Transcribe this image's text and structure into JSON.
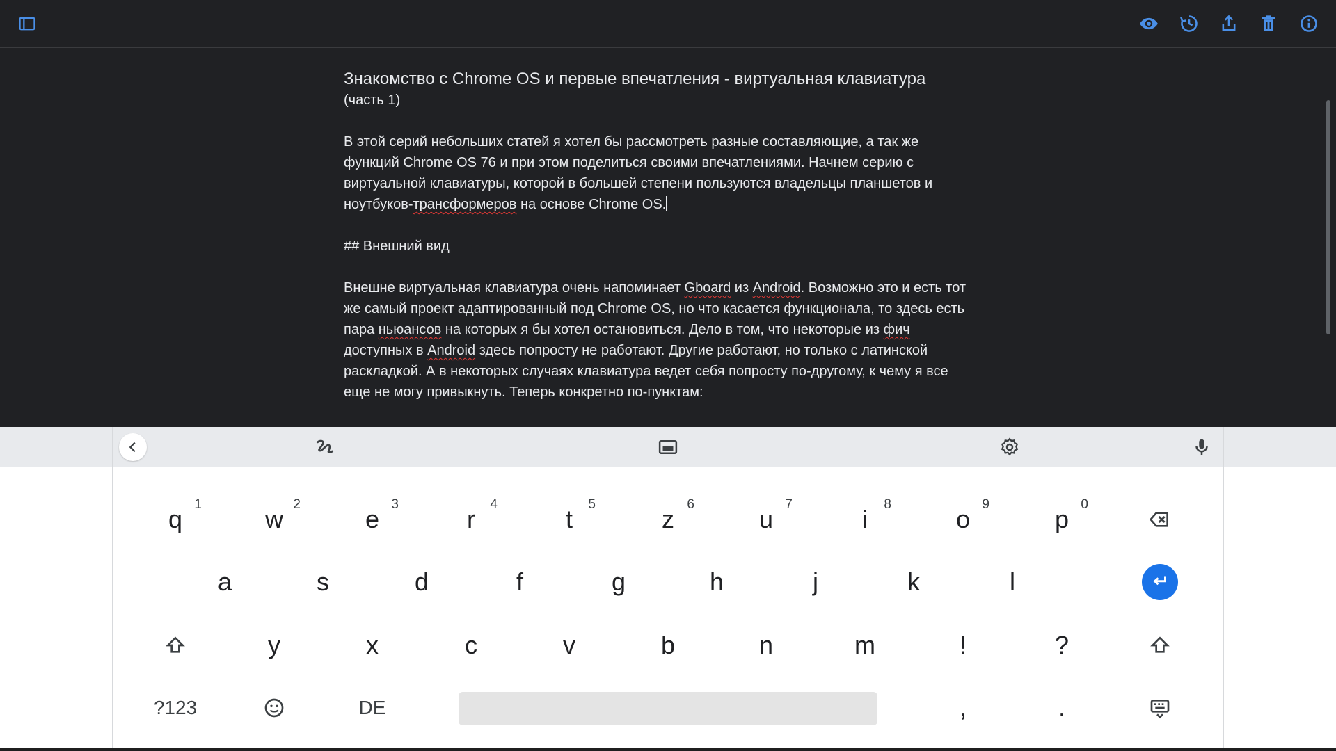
{
  "colors": {
    "accent": "#4a8fe7",
    "enter": "#1a73e8",
    "background": "#202124",
    "spell_error": "#e53935"
  },
  "topbar": {
    "left_icon": "sidebar-toggle-icon",
    "right_icons": [
      "eye-icon",
      "history-icon",
      "share-icon",
      "trash-icon",
      "info-icon"
    ]
  },
  "document": {
    "title": "Знакомство с Chrome OS и первые впечатления - виртуальная клавиатура",
    "subtitle": "(часть 1)",
    "p1_a": "В этой серий небольших статей я хотел бы рассмотреть разные составляющие, а так же\nфункций Chrome OS 76 и при этом поделиться своими впечатлениями. Начнем серию с\nвиртуальной клавиатуры, которой в большей степени пользуются владельцы планшетов и\nноутбуков-",
    "p1_b": "трансформеров",
    "p1_c": " на основе Chrome OS.",
    "heading": "## Внешний вид",
    "p2_1": "Внешне виртуальная клавиатура очень напоминает ",
    "p2_gboard": "Gboard",
    "p2_2": " из ",
    "p2_android1": "Android",
    "p2_3": ". Возможно это и есть тот\nже самый проект адаптированный под Chrome OS, но что касается функционала, то здесь есть\nпара ",
    "p2_nuances": "ньюансов",
    "p2_4": " на которых я бы хотел остановиться. Дело в том, что некоторые из ",
    "p2_fich": "фич",
    "p2_5": "\nдоступных в ",
    "p2_android2": "Android",
    "p2_6": " здесь попросту не работают. Другие работают, но только с латинской\nраскладкой. А в некоторых случаях клавиатура ведет себя попросту по-другому, к чему я все\nеще не могу привыкнуть. Теперь конкретно по-пунктам:"
  },
  "keyboard": {
    "toolbar_icons": [
      "chevron-left-icon",
      "handwriting-icon",
      "floating-keyboard-icon",
      "settings-icon",
      "microphone-icon"
    ],
    "row1": [
      "q",
      "w",
      "e",
      "r",
      "t",
      "z",
      "u",
      "i",
      "o",
      "p"
    ],
    "row1_hints": [
      "1",
      "2",
      "3",
      "4",
      "5",
      "6",
      "7",
      "8",
      "9",
      "0"
    ],
    "row2": [
      "a",
      "s",
      "d",
      "f",
      "g",
      "h",
      "j",
      "k",
      "l"
    ],
    "row3": [
      "y",
      "x",
      "c",
      "v",
      "b",
      "n",
      "m",
      "!",
      "?"
    ],
    "symbols_label": "?123",
    "language_label": "DE",
    "comma": ",",
    "period": "."
  }
}
